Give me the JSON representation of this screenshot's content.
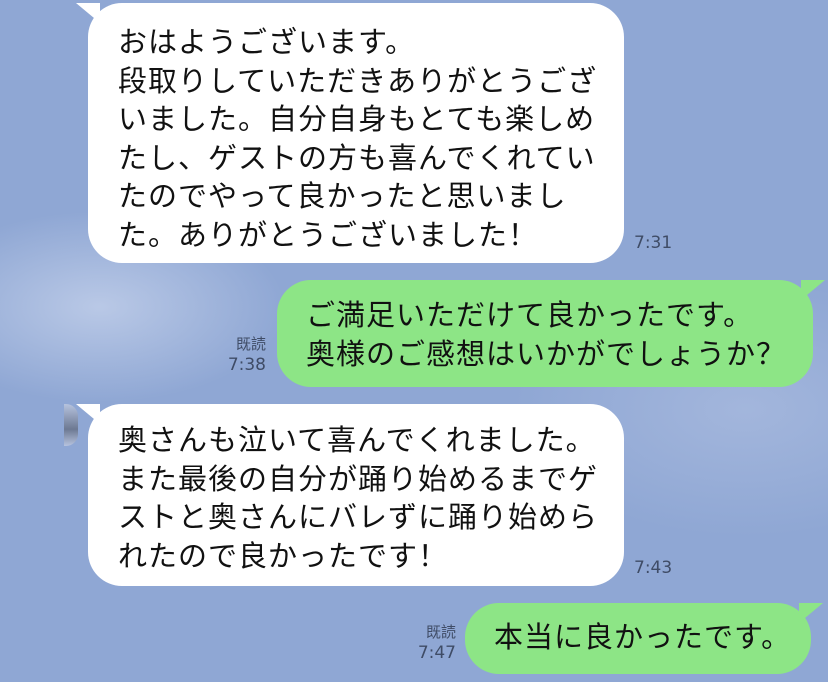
{
  "messages": [
    {
      "direction": "incoming",
      "lines": [
        "おはようございます。",
        "段取りしていただきありがとうござ",
        "いました。自分自身もとても楽しめ",
        "たし、ゲストの方も喜んでくれてい",
        "たのでやって良かったと思いまし",
        "た。ありがとうございました！"
      ],
      "time": "7:31"
    },
    {
      "direction": "outgoing",
      "lines": [
        "ご満足いただけて良かったです。",
        "奥様のご感想はいかがでしょうか？"
      ],
      "read": "既読",
      "time": "7:38"
    },
    {
      "direction": "incoming",
      "lines": [
        "奥さんも泣いて喜んでくれました。",
        "また最後の自分が踊り始めるまでゲ",
        "ストと奥さんにバレずに踊り始めら",
        "れたので良かったです！"
      ],
      "time": "7:43"
    },
    {
      "direction": "outgoing",
      "lines": [
        "本当に良かったです。"
      ],
      "read": "既読",
      "time": "7:47"
    }
  ],
  "colors": {
    "background": "#8fa7d4",
    "incoming_bubble": "#ffffff",
    "outgoing_bubble": "#8de586",
    "meta_text": "#3f4c66"
  }
}
